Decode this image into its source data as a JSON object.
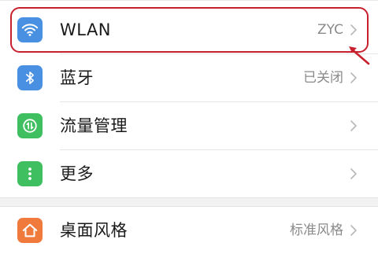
{
  "settings": {
    "items": [
      {
        "label": "WLAN",
        "value": "ZYC",
        "icon": "wifi-icon",
        "icon_color": "#4a90e2"
      },
      {
        "label": "蓝牙",
        "value": "已关闭",
        "icon": "bluetooth-icon",
        "icon_color": "#4a90e2"
      },
      {
        "label": "流量管理",
        "value": "",
        "icon": "data-usage-icon",
        "icon_color": "#3fbf5f"
      },
      {
        "label": "更多",
        "value": "",
        "icon": "more-dots-icon",
        "icon_color": "#3fbf5f"
      },
      {
        "label": "桌面风格",
        "value": "标准风格",
        "icon": "home-icon",
        "icon_color": "#f07a3c"
      }
    ]
  },
  "annotation": {
    "highlight_color": "#c8202c"
  }
}
